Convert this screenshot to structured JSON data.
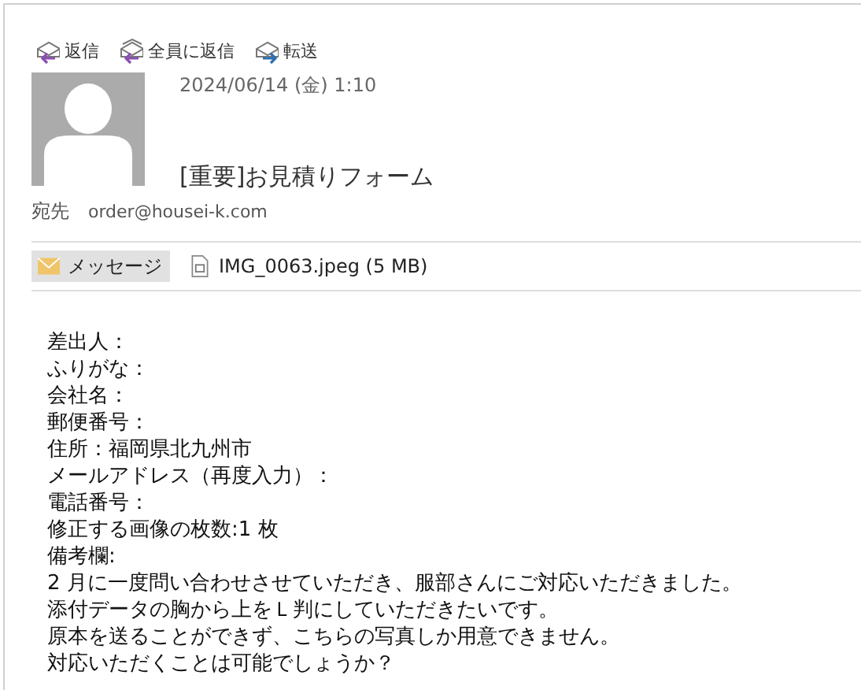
{
  "actions": [
    {
      "label": "返信",
      "kind": "reply"
    },
    {
      "label": "全員に返信",
      "kind": "reply_all"
    },
    {
      "label": "転送",
      "kind": "forward"
    }
  ],
  "message": {
    "date": "2024/06/14 (金) 1:10",
    "subject": "[重要]お見積りフォーム",
    "to_label": "宛先",
    "to": "order@housei-k.com"
  },
  "attachments": [
    {
      "label": "メッセージ",
      "kind": "message",
      "selected": true
    },
    {
      "label": "IMG_0063.jpeg (5 MB)",
      "kind": "file",
      "selected": false
    }
  ],
  "body_lines": [
    "差出人：",
    "ふりがな：",
    "会社名：",
    "郵便番号：",
    "住所：福岡県北九州市",
    "メールアドレス（再度入力）：",
    "電話番号：",
    "修正する画像の枚数:1 枚",
    "備考欄:",
    "2 月に一度問い合わせさせていただき、服部さんにご対応いただきました。",
    "添付データの胸から上をＬ判にしていただきたいです。",
    "原本を送ることができず、こちらの写真しか用意できません。",
    "対応いただくことは可能でしょうか？"
  ]
}
